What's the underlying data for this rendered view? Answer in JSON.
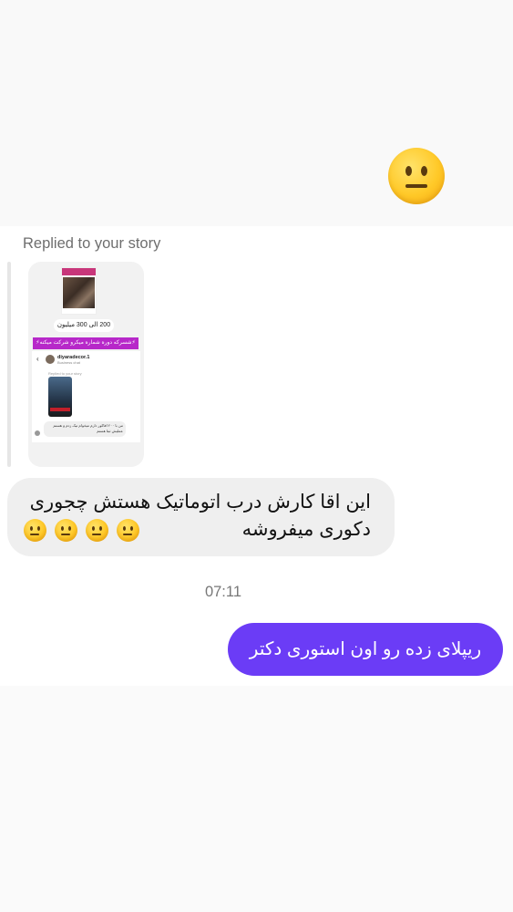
{
  "thread": {
    "top_message": {
      "emoji": "neutral-face-emoji"
    },
    "story_reply": {
      "label": "Replied to your story",
      "story_preview": {
        "price_text": "200 الی 300 میلیون",
        "banner_text": "⚡شسرکه دوره شماره میکرو شرکت میکنه⚡",
        "username": "diyaradecor.1",
        "user_subtitle": "Business chat",
        "mini_replied": "Replied to your story",
        "mini_message": "من با ۲۰۰ افاکور دارم میخوام تیک زدم و هستم عملیش ثبتا هستم"
      }
    },
    "received_message": {
      "text": "این اقا کارش درب اتوماتیک هستش چجوری دکوری میفروشه",
      "emoji_count": 4,
      "emoji": "neutral-face-emoji"
    },
    "timestamp": "07:11",
    "sent_message": {
      "text": "ریپلای زده رو اون استوری دکتر"
    }
  },
  "colors": {
    "sent_bubble": "#6b3cf6",
    "received_bubble": "#efefef",
    "page_background": "#ffffff"
  }
}
